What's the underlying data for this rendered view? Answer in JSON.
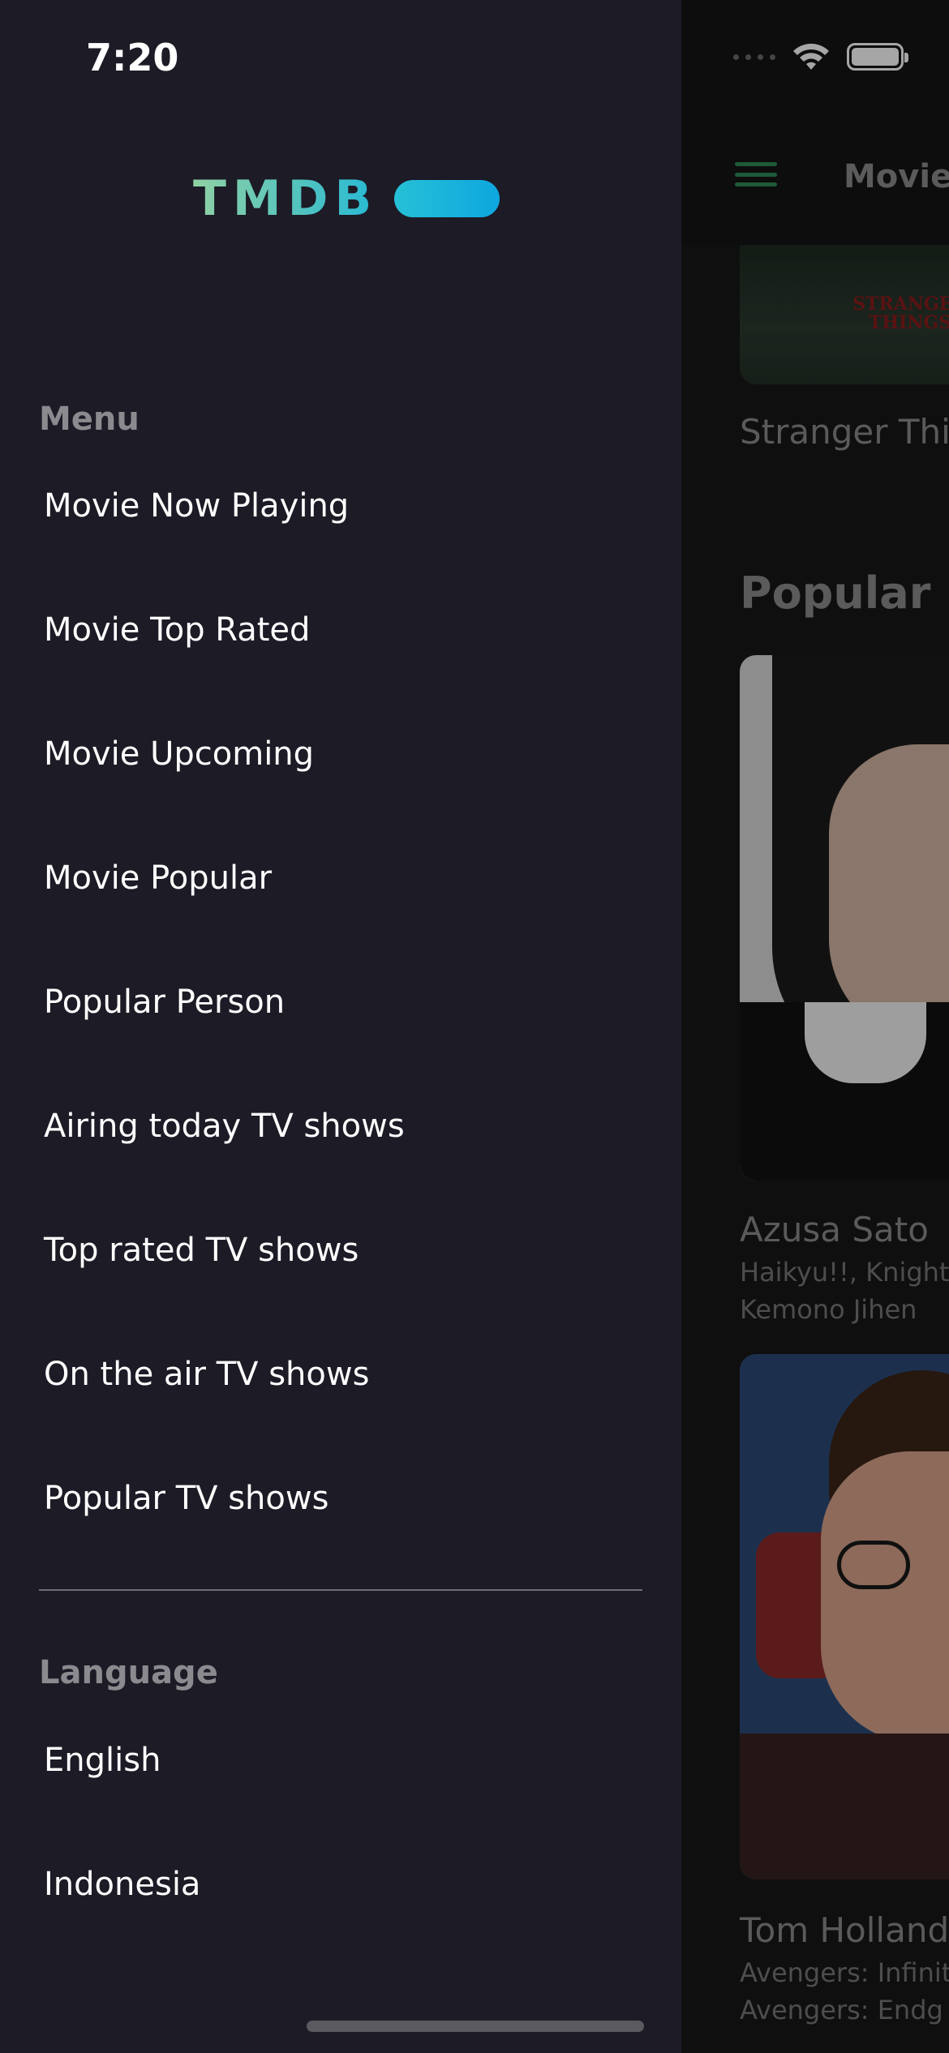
{
  "status_bar": {
    "time": "7:20"
  },
  "brand": {
    "logo_text": "TMDB",
    "accent_start": "#8fd1a3",
    "accent_end": "#0ea7e0"
  },
  "drawer": {
    "menu_header": "Menu",
    "menu_items": [
      {
        "label": "Movie Now Playing"
      },
      {
        "label": "Movie Top Rated"
      },
      {
        "label": "Movie Upcoming"
      },
      {
        "label": "Movie Popular"
      },
      {
        "label": "Popular Person"
      },
      {
        "label": "Airing today TV shows"
      },
      {
        "label": "Top rated TV shows"
      },
      {
        "label": "On the air TV shows"
      },
      {
        "label": "Popular TV shows"
      }
    ],
    "language_header": "Language",
    "language_items": [
      {
        "label": "English"
      },
      {
        "label": "Indonesia"
      }
    ]
  },
  "main": {
    "appbar_title": "Movie",
    "poster_title": "Stranger Thi",
    "poster_logo": "STRANGER THINGS",
    "section_title": "Popular P",
    "people": [
      {
        "name": "Azusa Sato",
        "known_for_1": "Haikyu!!, Knights",
        "known_for_2": "Kemono Jihen"
      },
      {
        "name": "Tom Holland",
        "known_for_1": "Avengers: Infinit",
        "known_for_2": "Avengers: Endg"
      }
    ]
  },
  "colors": {
    "drawer_bg": "#1c1b26",
    "hamburger": "#2e8b57",
    "header_text": "#8a8a8f"
  }
}
